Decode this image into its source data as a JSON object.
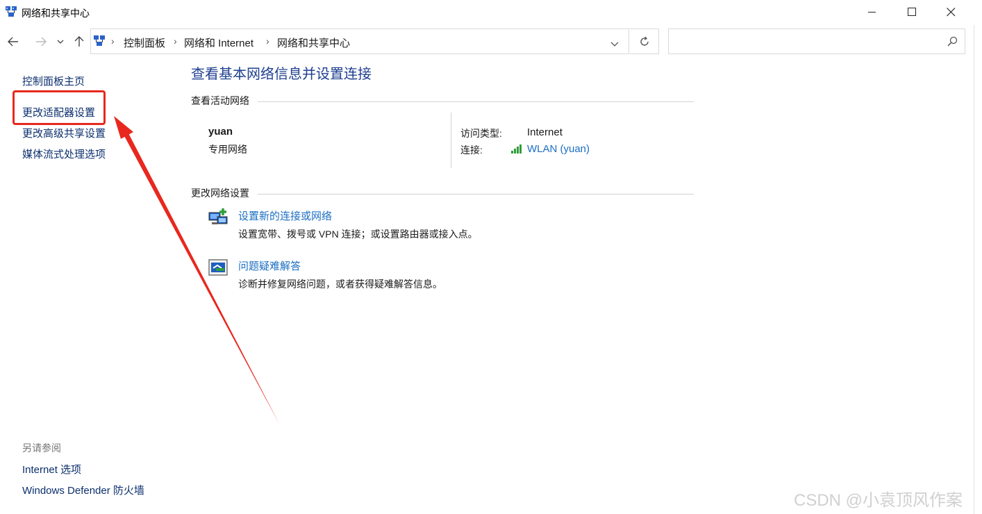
{
  "window": {
    "title": "网络和共享中心",
    "minimize_icon": "minimize-icon",
    "maximize_icon": "maximize-icon",
    "close_icon": "close-icon"
  },
  "address_bar": {
    "breadcrumbs": [
      "控制面板",
      "网络和 Internet",
      "网络和共享中心"
    ],
    "search_placeholder": ""
  },
  "sidebar": {
    "items": [
      {
        "label": "控制面板主页"
      },
      {
        "label": "更改适配器设置",
        "highlighted": true
      },
      {
        "label": "更改高级共享设置"
      },
      {
        "label": "媒体流式处理选项"
      }
    ],
    "see_also_label": "另请参阅",
    "see_also": [
      {
        "label": "Internet 选项"
      },
      {
        "label": "Windows Defender 防火墙"
      }
    ]
  },
  "main": {
    "title": "查看基本网络信息并设置连接",
    "active_networks_label": "查看活动网络",
    "network": {
      "name": "yuan",
      "type": "专用网络",
      "access_type_label": "访问类型:",
      "access_type_value": "Internet",
      "connection_label": "连接:",
      "connection_value": "WLAN (yuan)"
    },
    "change_settings_label": "更改网络设置",
    "actions": [
      {
        "title": "设置新的连接或网络",
        "desc": "设置宽带、拨号或 VPN 连接；或设置路由器或接入点。",
        "icon": "new-connection-icon"
      },
      {
        "title": "问题疑难解答",
        "desc": "诊断并修复网络问题，或者获得疑难解答信息。",
        "icon": "troubleshoot-icon"
      }
    ]
  },
  "annotation": {
    "highlight_color": "#e8281e",
    "arrow_color": "#e8281e"
  },
  "watermark": "CSDN @小袁顶风作案",
  "colors": {
    "link": "#1b6ec2",
    "title_blue": "#1e3f8f",
    "sidebar_link": "#0b2f6d"
  }
}
